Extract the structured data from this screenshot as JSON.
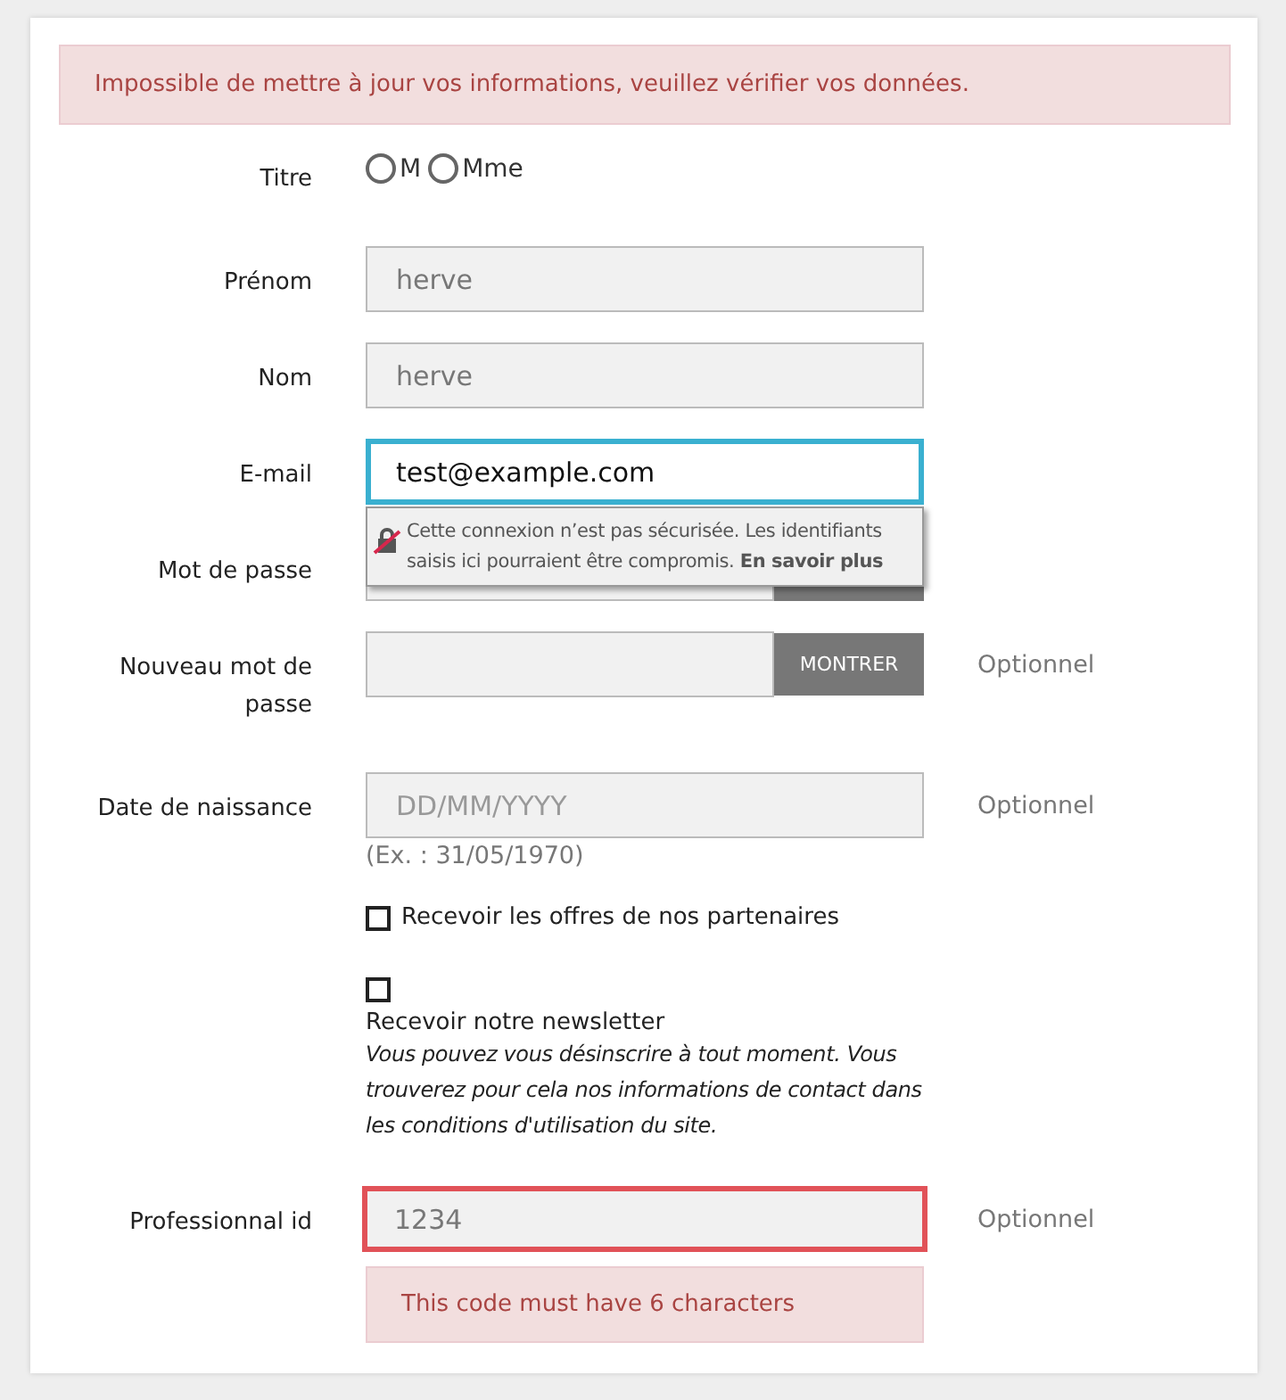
{
  "alert": {
    "text": "Impossible de mettre à jour vos informations, veuillez vérifier vos données."
  },
  "fields": [
    {
      "kind": "radio",
      "label": "Titre",
      "options": [
        {
          "label": "M",
          "selected": false
        },
        {
          "label": "Mme",
          "selected": false
        }
      ]
    },
    {
      "kind": "text",
      "label": "Prénom",
      "value": "herve"
    },
    {
      "kind": "text",
      "label": "Nom",
      "value": "herve"
    },
    {
      "kind": "text",
      "label": "E-mail",
      "value": "test@example.com",
      "focused": true,
      "tooltip": {
        "text": "Cette connexion n’est pas sécurisée. Les identifiants saisis ici pourraient être compromis.",
        "link": "En savoir plus"
      }
    },
    {
      "kind": "password",
      "label": "Mot de passe",
      "has_button": true
    },
    {
      "kind": "password",
      "label": "Nouveau mot de passe",
      "has_button": true,
      "button": "MONTRER",
      "note": "Optionnel"
    },
    {
      "kind": "text",
      "label": "Date de naissance",
      "placeholder": "DD/MM/YYYY",
      "hint": "(Ex. : 31/05/1970)",
      "note": "Optionnel"
    },
    {
      "kind": "checkbox",
      "label": "Recevoir les offres de nos partenaires",
      "checked": false
    },
    {
      "kind": "checkbox",
      "label": "Recevoir notre newsletter",
      "checked": false,
      "detail": "Vous pouvez vous désinscrire à tout moment. Vous trouverez pour cela nos informations de contact dans les conditions d'utilisation du site."
    },
    {
      "kind": "text",
      "label": "Professionnal id",
      "value": "1234",
      "invalid": true,
      "error": "This code must have 6 characters",
      "note": "Optionnel"
    }
  ]
}
